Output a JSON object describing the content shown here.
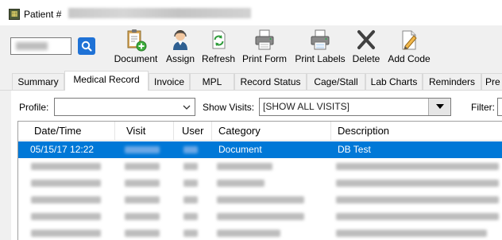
{
  "window": {
    "title": "Patient #"
  },
  "toolbar": {
    "patient_value": "",
    "buttons": [
      {
        "label": "Document",
        "icon": "document-add-icon"
      },
      {
        "label": "Assign",
        "icon": "user-assign-icon"
      },
      {
        "label": "Refresh",
        "icon": "refresh-icon"
      },
      {
        "label": "Print Form",
        "icon": "printer-icon"
      },
      {
        "label": "Print Labels",
        "icon": "printer-labels-icon"
      },
      {
        "label": "Delete",
        "icon": "delete-icon"
      },
      {
        "label": "Add Code",
        "icon": "add-code-icon"
      }
    ]
  },
  "tabs": [
    {
      "label": "Summary"
    },
    {
      "label": "Medical Record",
      "active": true
    },
    {
      "label": "Invoice"
    },
    {
      "label": "MPL"
    },
    {
      "label": "Record Status"
    },
    {
      "label": "Cage/Stall"
    },
    {
      "label": "Lab Charts"
    },
    {
      "label": "Reminders"
    },
    {
      "label": "Pre"
    }
  ],
  "filters": {
    "profile_label": "Profile:",
    "profile_value": "",
    "show_visits_label": "Show Visits:",
    "show_visits_value": "[SHOW ALL VISITS]",
    "filter_label": "Filter:"
  },
  "grid": {
    "columns": [
      "Date/Time",
      "Visit",
      "User",
      "Category",
      "Description"
    ],
    "rows": [
      {
        "datetime": "05/15/17 12:22",
        "category": "Document",
        "description": "DB Test",
        "selected": true
      }
    ]
  },
  "colors": {
    "selection": "#0078d7",
    "search_button": "#1f72d6",
    "delete_x": "#404040"
  }
}
